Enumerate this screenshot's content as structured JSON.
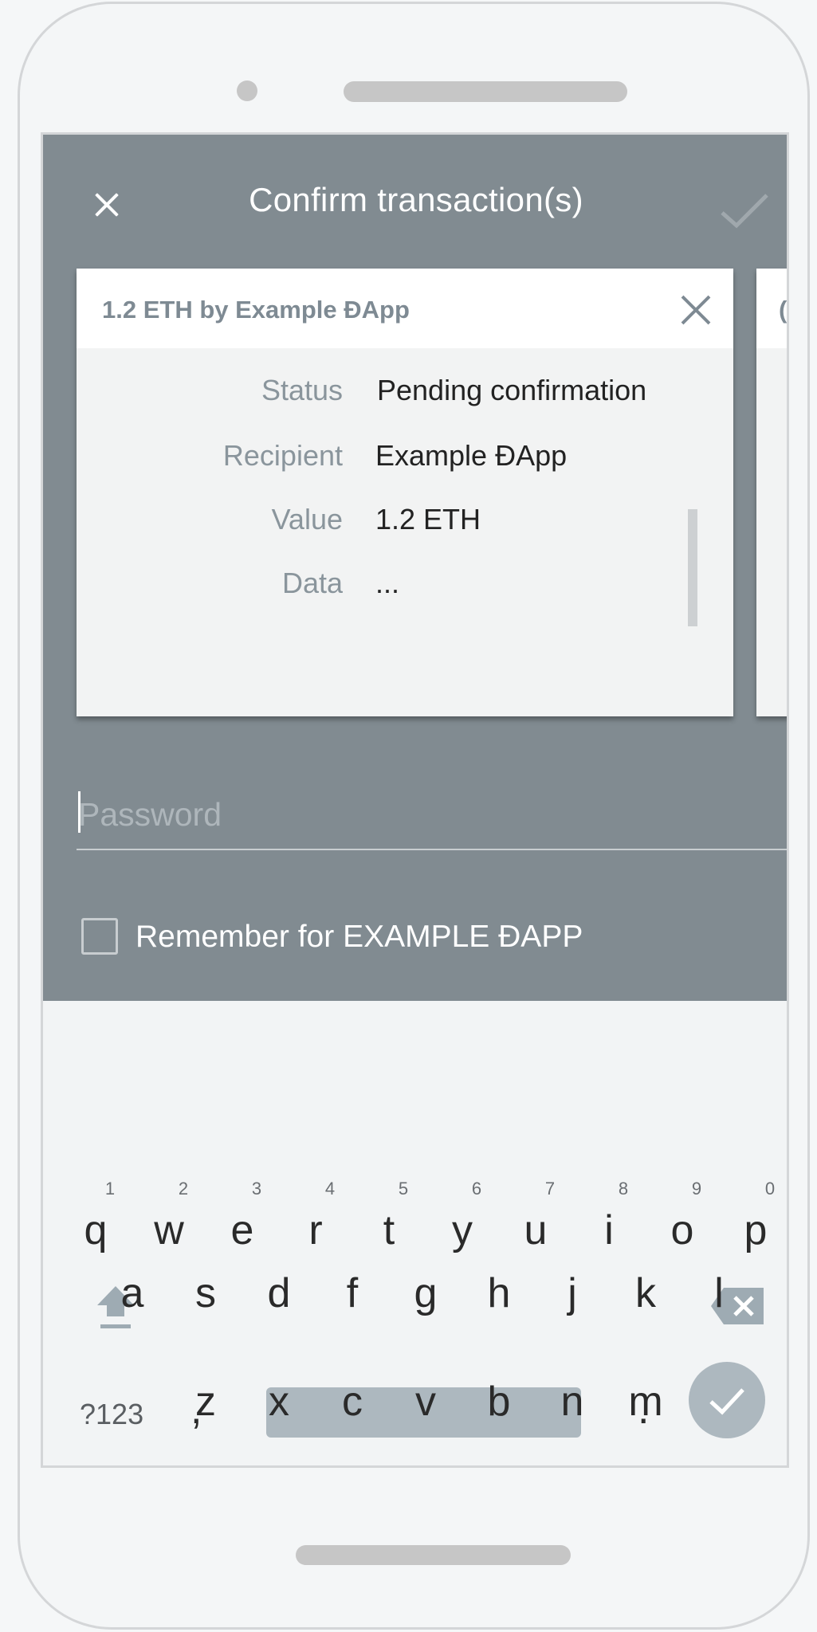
{
  "dialog": {
    "title": "Confirm transaction(s)",
    "close_icon": "close-icon",
    "confirm_icon": "check-icon"
  },
  "card": {
    "title": "1.2 ETH by Example ĐApp",
    "rows": [
      {
        "label": "Status",
        "value": "Pending confirmation"
      },
      {
        "label": "Recipient",
        "value": "Example ĐApp"
      },
      {
        "label": "Value",
        "value": "1.2 ETH"
      },
      {
        "label": "Data",
        "value": "..."
      }
    ],
    "next_card_peek": "("
  },
  "password": {
    "placeholder": "Password"
  },
  "remember": {
    "label": "Remember for EXAMPLE ĐAPP",
    "checked": false
  },
  "keyboard": {
    "row1": [
      {
        "ch": "q",
        "hint": "1"
      },
      {
        "ch": "w",
        "hint": "2"
      },
      {
        "ch": "e",
        "hint": "3"
      },
      {
        "ch": "r",
        "hint": "4"
      },
      {
        "ch": "t",
        "hint": "5"
      },
      {
        "ch": "y",
        "hint": "6"
      },
      {
        "ch": "u",
        "hint": "7"
      },
      {
        "ch": "i",
        "hint": "8"
      },
      {
        "ch": "o",
        "hint": "9"
      },
      {
        "ch": "p",
        "hint": "0"
      }
    ],
    "row2": [
      "a",
      "s",
      "d",
      "f",
      "g",
      "h",
      "j",
      "k",
      "l"
    ],
    "row3": [
      "z",
      "x",
      "c",
      "v",
      "b",
      "n",
      "m"
    ],
    "symbols": "?123",
    "comma": ",",
    "period": "."
  },
  "colors": {
    "dialog_bg": "#818b91",
    "accent": "#adb8bf"
  }
}
